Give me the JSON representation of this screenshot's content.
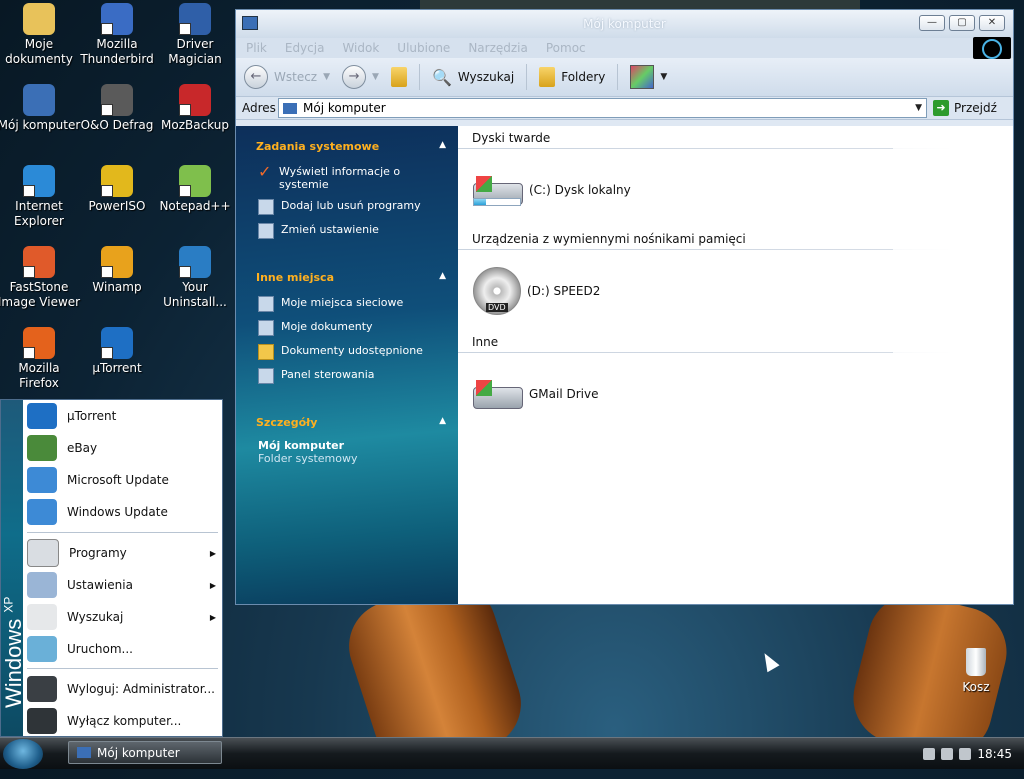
{
  "desktop": {
    "icons": [
      {
        "label": "Moje dokumenty",
        "color": "#e8c25a"
      },
      {
        "label": "Mozilla Thunderbird",
        "color": "#3a6cc4"
      },
      {
        "label": "Driver Magician",
        "color": "#2f5fa8"
      },
      {
        "label": "Mój komputer",
        "color": "#3b6fb6"
      },
      {
        "label": "O&O Defrag",
        "color": "#5a5a5a"
      },
      {
        "label": "MozBackup",
        "color": "#c8282a"
      },
      {
        "label": "Internet Explorer",
        "color": "#2b8ad7"
      },
      {
        "label": "PowerISO",
        "color": "#e2b81c"
      },
      {
        "label": "Notepad++",
        "color": "#7fbf4c"
      },
      {
        "label": "FastStone Image Viewer",
        "color": "#e05a2a"
      },
      {
        "label": "Winamp",
        "color": "#e8a21c"
      },
      {
        "label": "Your Uninstall...",
        "color": "#2a7dc4"
      },
      {
        "label": "Mozilla Firefox",
        "color": "#e4621c"
      },
      {
        "label": "µTorrent",
        "color": "#1e6fc4"
      }
    ],
    "recycle_bin": "Kosz"
  },
  "window": {
    "title": "Mój komputer",
    "menu": [
      "Plik",
      "Edycja",
      "Widok",
      "Ulubione",
      "Narzędzia",
      "Pomoc"
    ],
    "toolbar": {
      "back": "Wstecz",
      "search": "Wyszukaj",
      "folders": "Foldery"
    },
    "address": {
      "label": "Adres",
      "value": "Mój komputer",
      "go": "Przejdź"
    },
    "taskpane": {
      "system_tasks": {
        "title": "Zadania systemowe",
        "items": [
          "Wyświetl informacje o systemie",
          "Dodaj lub usuń programy",
          "Zmień ustawienie"
        ]
      },
      "other_places": {
        "title": "Inne miejsca",
        "items": [
          "Moje miejsca sieciowe",
          "Moje dokumenty",
          "Dokumenty udostępnione",
          "Panel sterowania"
        ]
      },
      "details": {
        "title": "Szczegóły",
        "name": "Mój komputer",
        "type": "Folder systemowy"
      }
    },
    "groups": {
      "hard_disks": {
        "title": "Dyski twarde",
        "item": "(C:) Dysk lokalny",
        "usage_fraction": 0.25
      },
      "removable": {
        "title": "Urządzenia z wymiennymi nośnikami pamięci",
        "item": "(D:) SPEED2",
        "badge": "DVD"
      },
      "other": {
        "title": "Inne",
        "item": "GMail Drive"
      }
    }
  },
  "start_menu": {
    "band_text": "Windows",
    "band_sup": "XP",
    "pinned": [
      {
        "label": "µTorrent",
        "color": "#1e6fc4"
      },
      {
        "label": "eBay",
        "color": "#4a8a3a"
      },
      {
        "label": "Microsoft Update",
        "color": "#3d8ad6"
      },
      {
        "label": "Windows Update",
        "color": "#3d8ad6"
      }
    ],
    "programs": "Programy",
    "settings": "Ustawienia",
    "search": "Wyszukaj",
    "run": "Uruchom...",
    "logoff": "Wyloguj: Administrator...",
    "shutdown": "Wyłącz komputer..."
  },
  "taskbar": {
    "task": "Mój komputer",
    "clock": "18:45"
  }
}
